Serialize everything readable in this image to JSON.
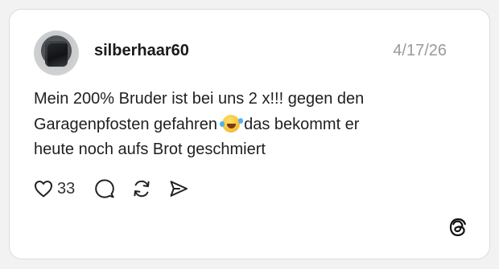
{
  "post": {
    "username": "silberhaar60",
    "date": "4/17/26",
    "text_line1": "Mein 200% Bruder ist bei uns 2 x!!! gegen den",
    "text_line2_before_emoji": "Garagenpfosten gefahren ",
    "text_line2_after_emoji": " das bekommt er",
    "text_line3": "heute noch aufs Brot geschmiert",
    "emoji_icon": "rolling-on-floor-laughing-emoji"
  },
  "actions": {
    "like_count": "33",
    "icons": [
      "heart-icon",
      "comment-icon",
      "repost-icon",
      "share-icon"
    ]
  },
  "brand": {
    "logo_icon": "threads-logo-icon"
  },
  "colors": {
    "card_background": "#ffffff",
    "page_background": "#f2f2f2",
    "date_text": "#9a9a9a"
  }
}
